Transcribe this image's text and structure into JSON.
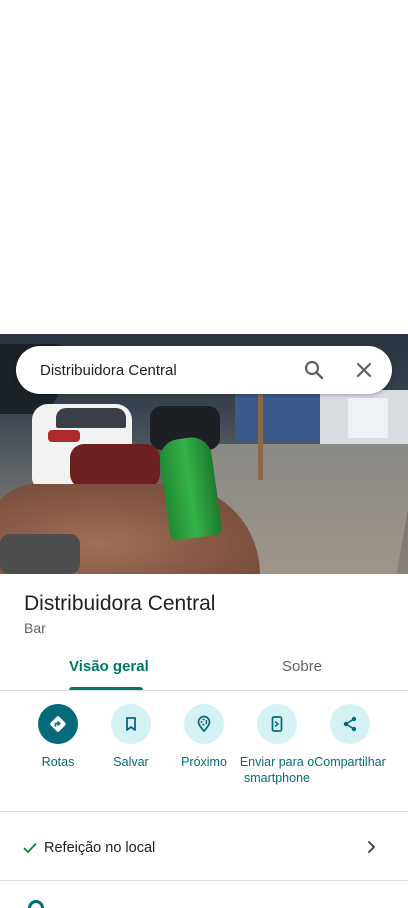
{
  "search": {
    "query": "Distribuidora Central"
  },
  "place": {
    "name": "Distribuidora Central",
    "category": "Bar"
  },
  "tabs": [
    {
      "label": "Visão geral",
      "selected": true
    },
    {
      "label": "Sobre",
      "selected": false
    }
  ],
  "actions": [
    {
      "label": "Rotas",
      "icon": "directions-icon"
    },
    {
      "label": "Salvar",
      "icon": "bookmark-icon"
    },
    {
      "label": "Próximo",
      "icon": "nearby-icon"
    },
    {
      "label": "Enviar para o smartphone",
      "icon": "send-to-phone-icon"
    },
    {
      "label": "Compartilhar",
      "icon": "share-icon"
    }
  ],
  "features": {
    "dine_in": "Refeição no local"
  },
  "colors": {
    "accent": "#056a7a",
    "tab_accent": "#00796b",
    "action_bg": "#d4f1f3"
  }
}
